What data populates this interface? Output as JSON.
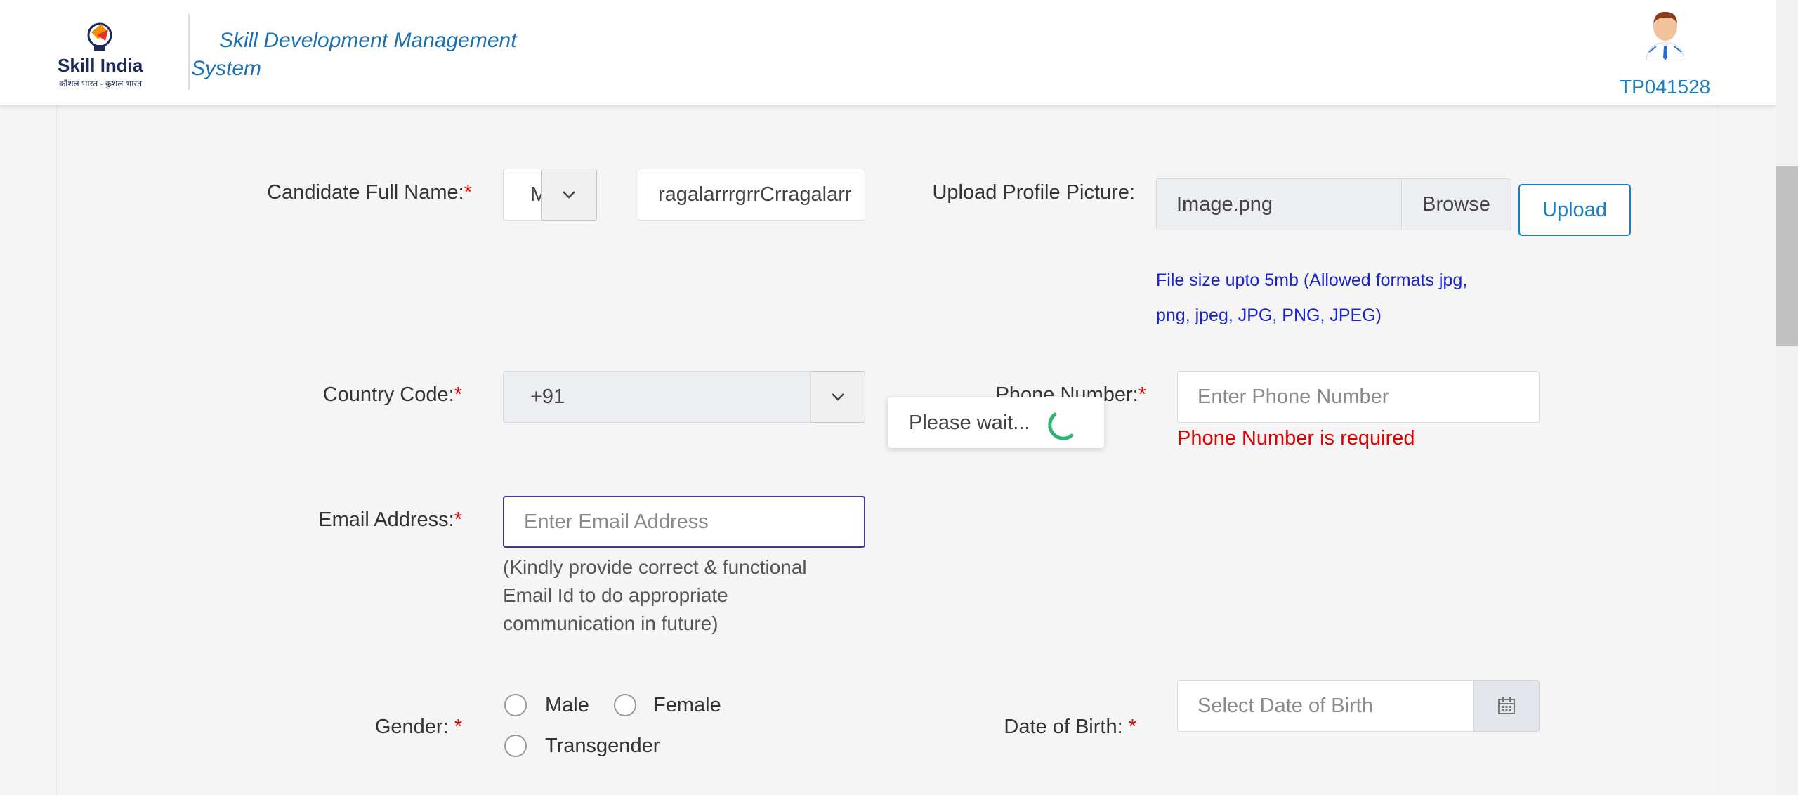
{
  "header": {
    "logo_text": "Skill India",
    "logo_subtitle": "कौशल भारत - कुशल भारत",
    "app_title": "Skill Development Management System",
    "user_id": "TP041528"
  },
  "form": {
    "full_name": {
      "label": "Candidate Full Name:",
      "required_mark": "*",
      "salutation_value": "M",
      "name_value": "ragalarrrgrrCrragalarr"
    },
    "profile_picture": {
      "label": "Upload Profile Picture:",
      "file_value": "Image.png",
      "browse_label": "Browse",
      "upload_label": "Upload",
      "note_line1": "File size upto 5mb (Allowed formats jpg,",
      "note_line2": "png, jpeg, JPG, PNG, JPEG)"
    },
    "country_code": {
      "label": "Country Code:",
      "required_mark": "*",
      "value": "+91"
    },
    "phone": {
      "label": "Phone Number:",
      "required_mark": "*",
      "placeholder": "Enter Phone Number",
      "error": "Phone Number is required"
    },
    "email": {
      "label": "Email Address:",
      "required_mark": "*",
      "placeholder": "Enter Email Address",
      "note_line1": "(Kindly provide correct & functional",
      "note_line2": "Email Id to do appropriate",
      "note_line3": "communication in future)"
    },
    "gender": {
      "label": "Gender: ",
      "required_mark": "*",
      "options": [
        "Male",
        "Female",
        "Transgender"
      ]
    },
    "dob": {
      "label": "Date of Birth: ",
      "required_mark": "*",
      "placeholder": "Select Date of Birth"
    }
  },
  "loading": {
    "text": "Please wait..."
  },
  "colors": {
    "brand_blue": "#1a7fc1",
    "required_red": "#e00000",
    "note_blue": "#1a22cc",
    "spinner_green": "#2bb673"
  },
  "icons": [
    "user-avatar-icon",
    "chevron-down-icon",
    "calendar-icon",
    "spinner-icon"
  ]
}
